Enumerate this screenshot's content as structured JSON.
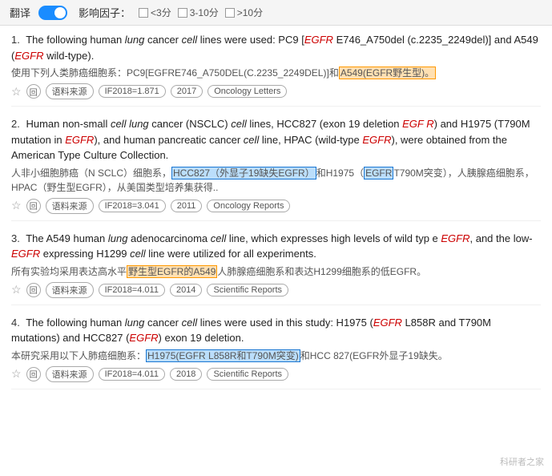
{
  "topbar": {
    "translate_label": "翻译",
    "influence_label": "影响因子：",
    "filters": [
      {
        "label": "<3分",
        "checked": false
      },
      {
        "label": "3-10分",
        "checked": false
      },
      {
        " label": ">10分",
        "checked": false
      }
    ]
  },
  "results": [
    {
      "number": "1.",
      "en_text": "The following human lung cancer cell lines were used: PC9 [EGFR E746_A750del (c.2235_2249del)] and A549 (EGFR wild-type).",
      "cn_text": "使用下列人类肺癌细胞系：PC9[EGFRE746_A750DEL(C.2235_2249DEL)]和A549(EGFR野生型)。",
      "highlight_cn": "A549(EGFR野生型)。",
      "tags": [
        "语料来源",
        "IF2018=1.871",
        "2017",
        "Oncology Letters"
      ]
    },
    {
      "number": "2.",
      "en_text": "Human non-small cell lung cancer (NSCLC) cell lines, HCC827 (exon 19 deletion EGFR) and H1975 (T790M mutation in EGFR), and human pancreatic cancer cell line, HPAC (wild-type EGFR), were obtained from the American Type Culture Collection.",
      "cn_text": "人非小细胞肺癌（N SCLC）细胞系，HCC827（外显子19缺失EGFR）和H1975（EGFR T790M突变），人胰腺癌细胞系，HPAC（野生型EGFR），从美国类型培养集获得..",
      "highlight_cn_1": "HCC827（外显子19缺失EGFR）",
      "highlight_cn_2": "EGFR",
      "tags": [
        "语料来源",
        "IF2018=3.041",
        "2011",
        "Oncology Reports"
      ]
    },
    {
      "number": "3.",
      "en_text": "The A549 human lung adenocarcinoma cell line, which expresses high levels of wild type EGFR, and the low-EGFR expressing H1299 cell line were utilized for all experiments.",
      "cn_text": "所有实验均采用表达高水平野生型EGFR的A549人肺腺癌细胞系和表达H1299细胞系的低EGFR。",
      "highlight_cn": "野生型EGFR的A549",
      "tags": [
        "语料来源",
        "IF2018=4.011",
        "2014",
        "Scientific Reports"
      ]
    },
    {
      "number": "4.",
      "en_text": "The following human lung cancer cell lines were used in this study: H1975 (EGFR L858R and T790M mutations) and HCC827 (EGFR exon 19 deletion.",
      "cn_text": "本研究采用以下人肺癌细胞系：H1975(EGFR L858R和T790M突变)和HCC 827(EGFR外显子19缺失。",
      "highlight_cn": "H1975(EGFR L858R和T790M突变)",
      "tags": [
        "语料来源",
        "IF2018=4.011",
        "2018",
        "Scientific Reports"
      ]
    }
  ],
  "watermark": "科研者之家"
}
